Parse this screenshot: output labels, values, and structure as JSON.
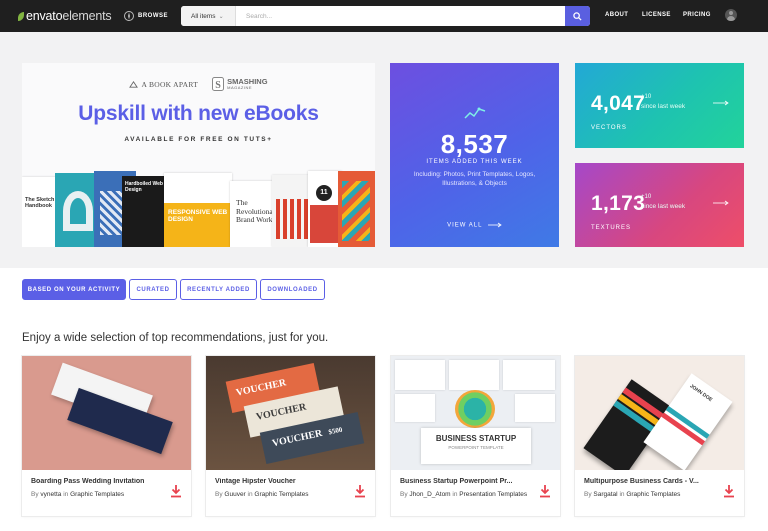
{
  "header": {
    "logo_main": "envato",
    "logo_light": "elements",
    "browse_label": "BROWSE",
    "search_category": "All items",
    "search_placeholder": "Search...",
    "nav": [
      "ABOUT",
      "LICENSE",
      "PRICING"
    ]
  },
  "promo": {
    "brand1": "A BOOK APART",
    "brand2": "SMASHING",
    "brand2_sub": "MAGAZINE",
    "title": "Upskill with new eBooks",
    "subtitle": "AVAILABLE FOR FREE ON TUTS+",
    "books": {
      "b1": "The Sketch Handbook",
      "b2": "Hardboiled Web Design",
      "b3": "RESPONSIVE WEB DESIGN",
      "b4": "The Revolutionary Brand Workbook",
      "b5": "11"
    }
  },
  "stats": {
    "main": {
      "value": "8,537",
      "label": "ITEMS ADDED THIS WEEK",
      "description": "Including: Photos, Print Templates, Logos, Illustrations, & Objects",
      "view_all": "VIEW ALL"
    },
    "vectors": {
      "value": "4,047",
      "plus": "+10",
      "since": "since last week",
      "label": "VECTORS"
    },
    "textures": {
      "value": "1,173",
      "plus": "+10",
      "since": "since last week",
      "label": "TEXTURES"
    }
  },
  "tabs": [
    "BASED ON YOUR ACTIVITY",
    "CURATED",
    "RECENTLY ADDED",
    "DOWNLOADED"
  ],
  "section_heading": "Enjoy a wide selection of top recommendations, just for you.",
  "cards": [
    {
      "title": "Boarding Pass Wedding Invitation",
      "by": "By",
      "author": "vynetta",
      "in": "in",
      "category": "Graphic Templates"
    },
    {
      "title": "Vintage Hipster Voucher",
      "by": "By",
      "author": "Guuver",
      "in": "in",
      "category": "Graphic Templates"
    },
    {
      "title": "Business Startup Powerpoint Pr...",
      "by": "By",
      "author": "Jhon_D_Atom",
      "in": "in",
      "category": "Presentation Templates"
    },
    {
      "title": "Multipurpose Business Cards - V...",
      "by": "By",
      "author": "Sargatal",
      "in": "in",
      "category": "Graphic Templates"
    }
  ],
  "thumb_text": {
    "voucher": "VOUCHER",
    "voucher_price": "$500",
    "startup_title": "BUSINESS STARTUP",
    "startup_sub": "POWERPOINT TEMPLATE",
    "bizcard_name": "JOHN DOE"
  },
  "colors": {
    "accent": "#5b5fe6",
    "nav_bg": "#1f1f1f",
    "download": "#e8424e",
    "brand_green": "#82b541"
  },
  "icons": [
    "envato-leaf-icon",
    "browse-grid-icon",
    "search-icon",
    "chevron-down-icon",
    "user-avatar-icon",
    "trend-chart-icon",
    "arrow-right-icon",
    "download-icon"
  ]
}
